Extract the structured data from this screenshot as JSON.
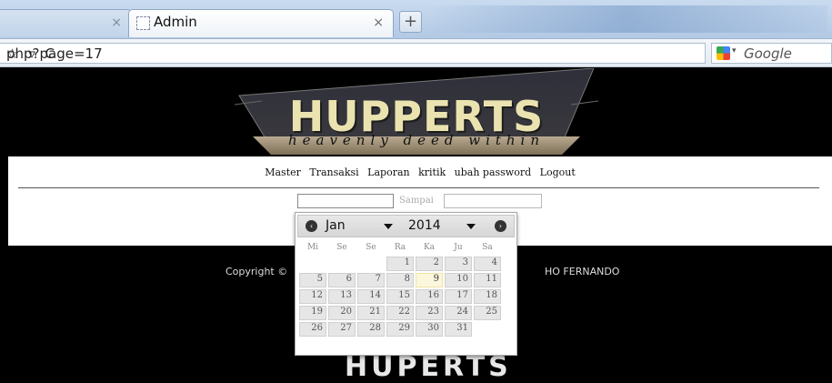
{
  "browser": {
    "inactive_tab_close": "×",
    "active_tab_title": "Admin",
    "active_tab_close": "×",
    "new_tab": "+",
    "url": "php?page=17",
    "url_icons": "☆ ▿ C",
    "search_engine": "Google",
    "search_dropdown": "▾"
  },
  "site": {
    "logo_title": "HUPPERTS",
    "logo_tagline": "heavenly deed within",
    "menu": [
      "Master",
      "Transaksi",
      "Laporan",
      "kritik",
      "ubah password",
      "Logout"
    ],
    "filter": {
      "sampai_label": "Sampai",
      "from_value": "",
      "to_value": ""
    },
    "footer_left": "Copyright ©",
    "footer_right": "HO FERNANDO",
    "footer_logo": "HUPERTS"
  },
  "calendar": {
    "prev_icon": "chevron-left-icon",
    "next_icon": "chevron-right-icon",
    "prev_glyph": "‹",
    "next_glyph": "›",
    "month": "Jan",
    "year": "2014",
    "weekdays": [
      "Mi",
      "Se",
      "Se",
      "Ra",
      "Ka",
      "Ju",
      "Sa"
    ],
    "weeks": [
      [
        "",
        "",
        "",
        "1",
        "2",
        "3",
        "4"
      ],
      [
        "5",
        "6",
        "7",
        "8",
        "9",
        "10",
        "11"
      ],
      [
        "12",
        "13",
        "14",
        "15",
        "16",
        "17",
        "18"
      ],
      [
        "19",
        "20",
        "21",
        "22",
        "23",
        "24",
        "25"
      ],
      [
        "26",
        "27",
        "28",
        "29",
        "30",
        "31",
        ""
      ]
    ],
    "today": "9"
  }
}
